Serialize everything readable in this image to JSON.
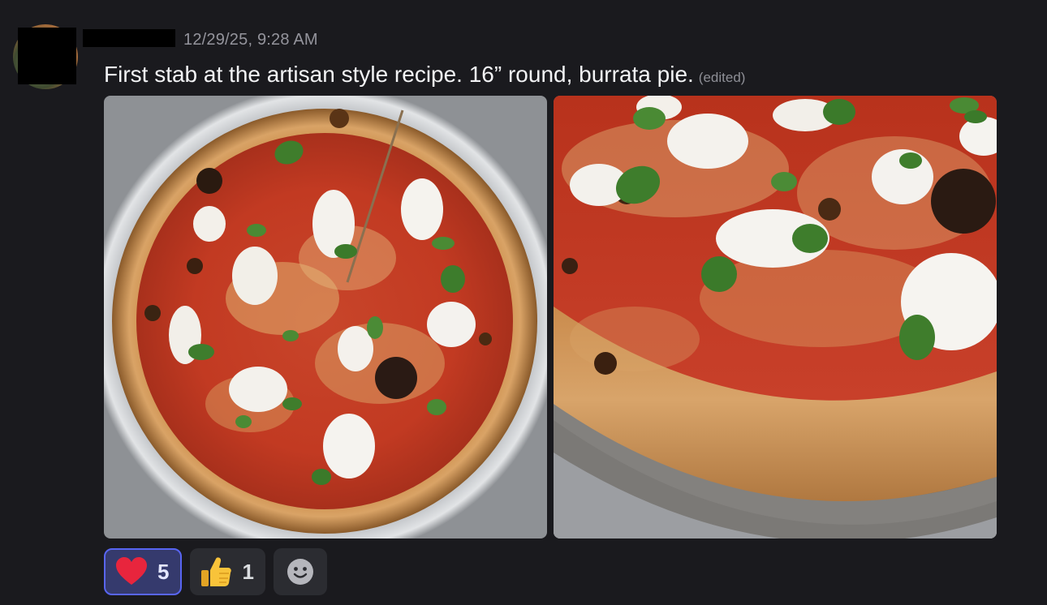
{
  "message": {
    "timestamp": "12/29/25, 9:28 AM",
    "text": "First stab at the artisan style recipe. 16” round, burrata pie.",
    "edited_label": "(edited)"
  },
  "attachments": [
    {
      "name": "pizza-top-view"
    },
    {
      "name": "pizza-close-up"
    }
  ],
  "reactions": [
    {
      "emoji": "heart-icon",
      "count": "5",
      "active": true
    },
    {
      "emoji": "thumbs-up-icon",
      "count": "1",
      "active": false
    }
  ],
  "add_reaction": {
    "icon": "smiley-icon"
  },
  "colors": {
    "background": "#1a1a1e",
    "active_reaction_border": "#5865f2",
    "active_reaction_bg": "#353a6d",
    "reaction_bg": "#2b2c31"
  }
}
